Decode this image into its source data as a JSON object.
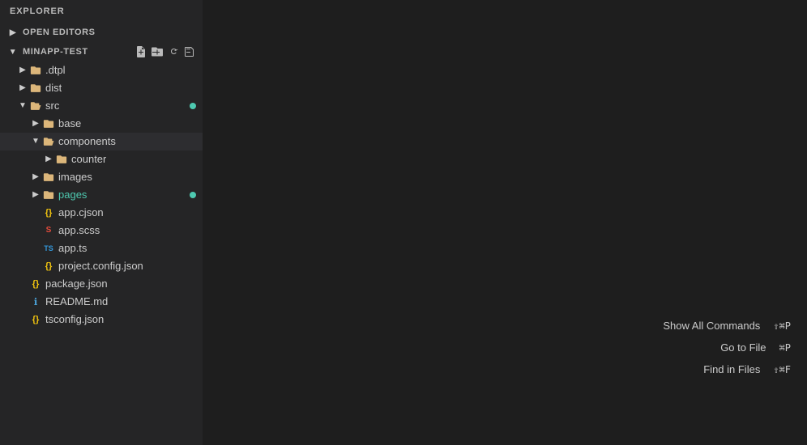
{
  "sidebar": {
    "title": "EXPLORER",
    "sections": {
      "open_editors": {
        "label": "OPEN EDITORS",
        "collapsed": true
      },
      "project": {
        "label": "MINAPP-TEST",
        "actions": [
          {
            "name": "new-file",
            "icon": "⬜",
            "title": "New File"
          },
          {
            "name": "new-folder",
            "icon": "📁",
            "title": "New Folder"
          },
          {
            "name": "refresh",
            "icon": "↺",
            "title": "Refresh"
          },
          {
            "name": "collapse-all",
            "icon": "⊟",
            "title": "Collapse All"
          }
        ]
      }
    },
    "tree": [
      {
        "id": "dtpl",
        "label": ".dtpl",
        "type": "folder",
        "indent": 1,
        "collapsed": true,
        "hasChevron": true
      },
      {
        "id": "dist",
        "label": "dist",
        "type": "folder",
        "indent": 1,
        "collapsed": true,
        "hasChevron": true
      },
      {
        "id": "src",
        "label": "src",
        "type": "folder",
        "indent": 1,
        "collapsed": false,
        "hasChevron": true,
        "badge": true
      },
      {
        "id": "base",
        "label": "base",
        "type": "folder",
        "indent": 2,
        "collapsed": true,
        "hasChevron": true
      },
      {
        "id": "components",
        "label": "components",
        "type": "folder",
        "indent": 2,
        "collapsed": false,
        "hasChevron": true,
        "selected": true
      },
      {
        "id": "counter",
        "label": "counter",
        "type": "folder",
        "indent": 3,
        "collapsed": true,
        "hasChevron": true
      },
      {
        "id": "images",
        "label": "images",
        "type": "folder",
        "indent": 2,
        "collapsed": true,
        "hasChevron": true
      },
      {
        "id": "pages",
        "label": "pages",
        "type": "folder",
        "indent": 2,
        "collapsed": true,
        "hasChevron": true,
        "badge": true,
        "color": "green"
      },
      {
        "id": "app-cjson",
        "label": "app.cjson",
        "type": "json",
        "indent": 2,
        "hasChevron": false
      },
      {
        "id": "app-scss",
        "label": "app.scss",
        "type": "scss",
        "indent": 2,
        "hasChevron": false
      },
      {
        "id": "app-ts",
        "label": "app.ts",
        "type": "ts",
        "indent": 2,
        "hasChevron": false
      },
      {
        "id": "project-config",
        "label": "project.config.json",
        "type": "json",
        "indent": 2,
        "hasChevron": false
      },
      {
        "id": "package-json",
        "label": "package.json",
        "type": "json",
        "indent": 1,
        "hasChevron": false
      },
      {
        "id": "readme",
        "label": "README.md",
        "type": "md",
        "indent": 1,
        "hasChevron": false
      },
      {
        "id": "tsconfig",
        "label": "tsconfig.json",
        "type": "json",
        "indent": 1,
        "hasChevron": false
      }
    ]
  },
  "commands": [
    {
      "label": "Show All Commands",
      "shortcut": "⇧⌘P"
    },
    {
      "label": "Go to File",
      "shortcut": "⌘P"
    },
    {
      "label": "Find in Files",
      "shortcut": "⇧⌘F"
    }
  ],
  "icons": {
    "chevron_right": "▶",
    "chevron_down": "▼",
    "folder": "📁",
    "json_icon": "{}",
    "scss_icon": "{}",
    "ts_icon": "TS",
    "md_icon": "ℹ"
  }
}
